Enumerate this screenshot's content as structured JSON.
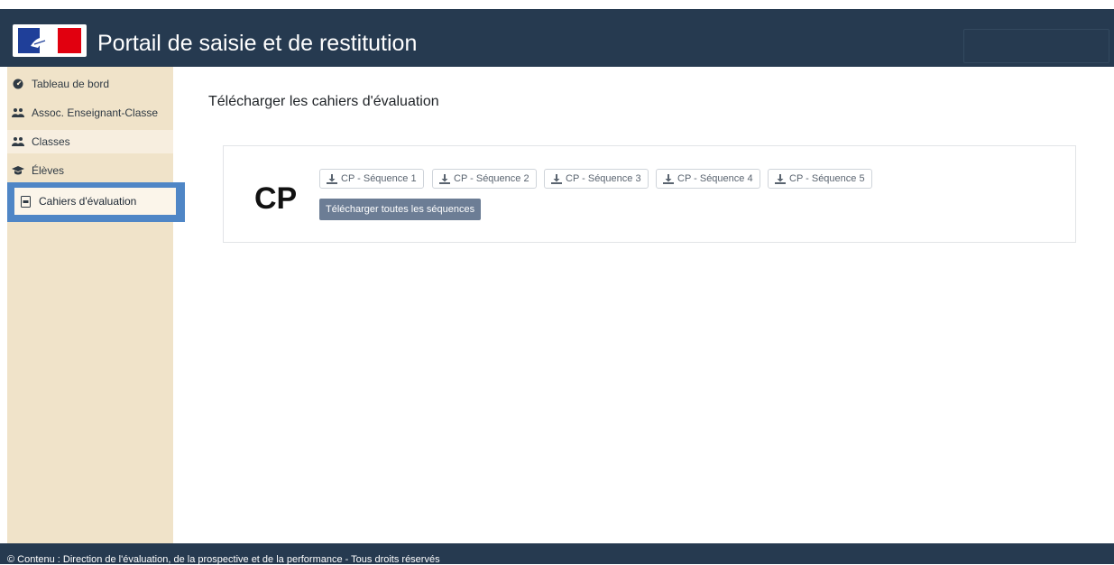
{
  "header": {
    "title": "Portail de saisie et de restitution"
  },
  "sidebar": {
    "items": [
      {
        "label": "Tableau de bord",
        "icon": "dashboard-icon"
      },
      {
        "label": "Assoc. Enseignant-Classe",
        "icon": "users-icon"
      },
      {
        "label": "Classes",
        "icon": "users-icon"
      },
      {
        "label": "Élèves",
        "icon": "graduation-cap-icon"
      },
      {
        "label": "Cahiers d'évaluation",
        "icon": "document-icon",
        "active": true
      }
    ]
  },
  "main": {
    "title": "Télécharger les cahiers d'évaluation",
    "level": "CP",
    "sequences": [
      "CP - Séquence 1",
      "CP - Séquence 2",
      "CP - Séquence 3",
      "CP - Séquence 4",
      "CP - Séquence 5"
    ],
    "download_all": "Télécharger toutes les séquences"
  },
  "footer": {
    "text": "© Contenu : Direction de l'évaluation, de la prospective et de la performance - Tous droits réservés"
  },
  "colors": {
    "header": "#263a50",
    "sidebar": "#f0e3c9",
    "active_highlight": "#4f86c6",
    "download_all_button": "#6c7d95"
  }
}
